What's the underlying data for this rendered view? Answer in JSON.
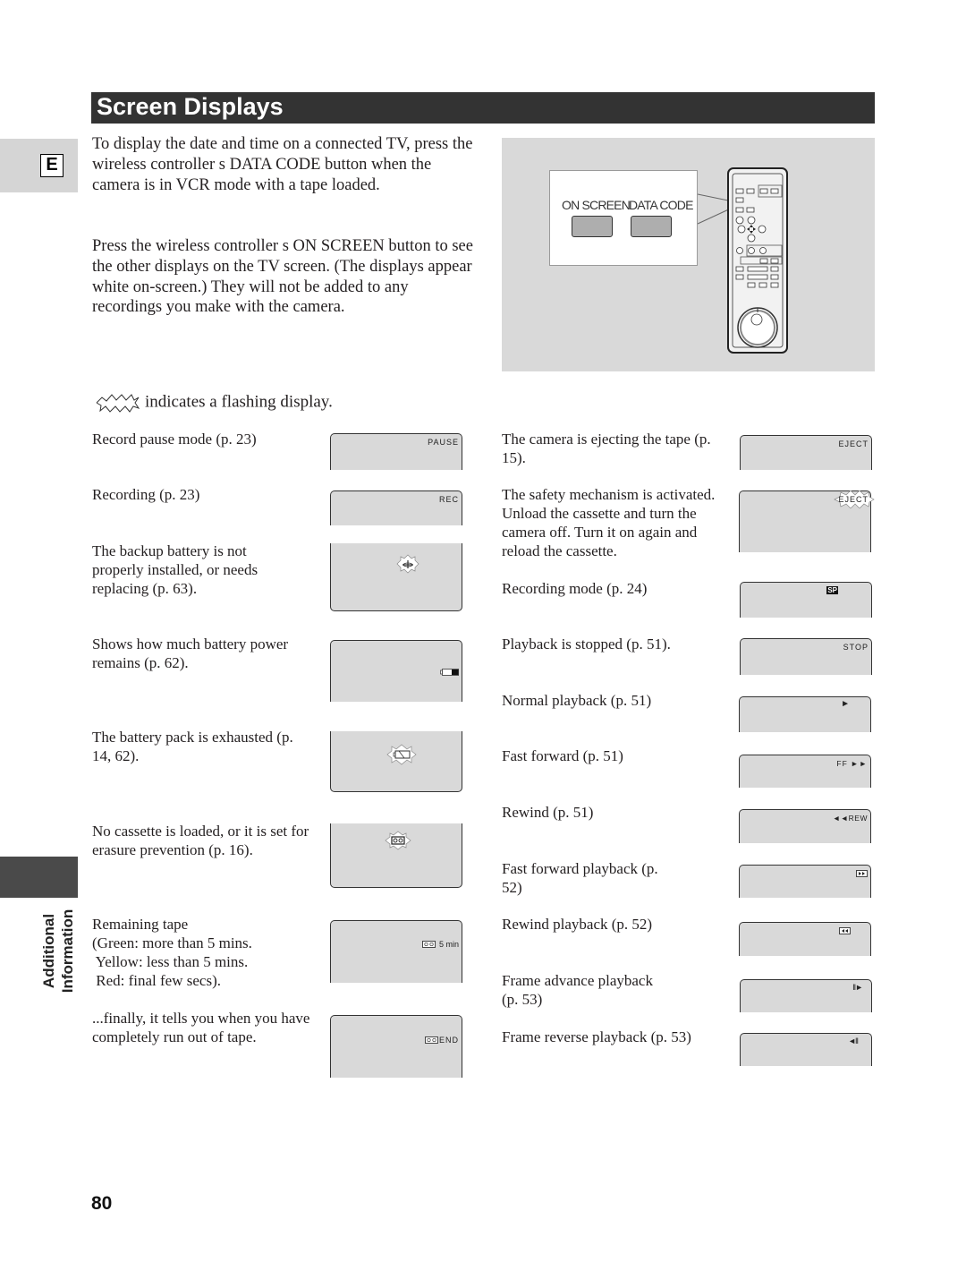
{
  "header": {
    "title": "Screen Displays"
  },
  "language_tab": {
    "letter": "E"
  },
  "side_section": {
    "label_line1": "Additional",
    "label_line2": "Information"
  },
  "intro": {
    "paragraph1": "To display the date and time on a connected TV, press the wireless controller s DATA CODE button when the camera is in VCR mode with a tape loaded.",
    "paragraph2": "Press the wireless controller s ON SCREEN button to see the other displays on the TV screen. (The displays appear white on-screen.) They will not be added to any recordings you make with the camera."
  },
  "illustration": {
    "on_screen_label": "ON SCREEN",
    "data_code_label": "DATA CODE"
  },
  "flash_note": {
    "text": "indicates a flashing display."
  },
  "left_column": [
    {
      "description": "Record pause mode (p. 23)",
      "indicator": "PAUSE"
    },
    {
      "description": "Recording (p. 23)",
      "indicator": "REC"
    },
    {
      "description": "The backup battery is not properly installed, or needs replacing (p. 63).",
      "indicator_icon": "backup-battery-flashing-icon"
    },
    {
      "description": "Shows how much battery power remains (p. 62).",
      "indicator_icon": "battery-level-icon"
    },
    {
      "description": "The battery pack is exhausted (p. 14, 62).",
      "indicator_icon": "battery-exhausted-flashing-icon"
    },
    {
      "description": "No cassette is loaded, or it is set for erasure prevention (p. 16).",
      "indicator_icon": "cassette-flashing-icon"
    },
    {
      "description_lines": [
        "Remaining tape",
        "(Green: more than 5 mins.",
        " Yellow: less than 5 mins.",
        " Red: final few secs)."
      ],
      "indicator": "5 min",
      "indicator_icon": "cassette-icon"
    },
    {
      "description": "...finally, it tells you when you have completely run out of tape.",
      "indicator": "END",
      "indicator_icon": "cassette-icon"
    }
  ],
  "right_column": [
    {
      "description": "The camera is ejecting the tape (p. 15).",
      "indicator": "EJECT"
    },
    {
      "description": "The safety mechanism is activated. Unload the cassette and turn the camera off. Turn it on again and reload the cassette.",
      "indicator": "EJECT",
      "flashing": true
    },
    {
      "description": "Recording mode (p. 24)",
      "indicator": "SP"
    },
    {
      "description": "Playback is stopped (p. 51).",
      "indicator": "STOP"
    },
    {
      "description": "Normal playback (p. 51)",
      "indicator": "►"
    },
    {
      "description": "Fast forward (p. 51)",
      "indicator": "FF ►►"
    },
    {
      "description": "Rewind (p. 51)",
      "indicator": "◄◄REW"
    },
    {
      "description": "Fast forward playback (p. 52)",
      "indicator_icon": "ff-playback-icon"
    },
    {
      "description": "Rewind playback (p. 52)",
      "indicator_icon": "rew-playback-icon"
    },
    {
      "description": "Frame advance playback (p. 53)",
      "indicator": "II►"
    },
    {
      "description": "Frame reverse playback (p. 53)",
      "indicator": "◄II"
    }
  ],
  "footer": {
    "page_number": "80"
  }
}
